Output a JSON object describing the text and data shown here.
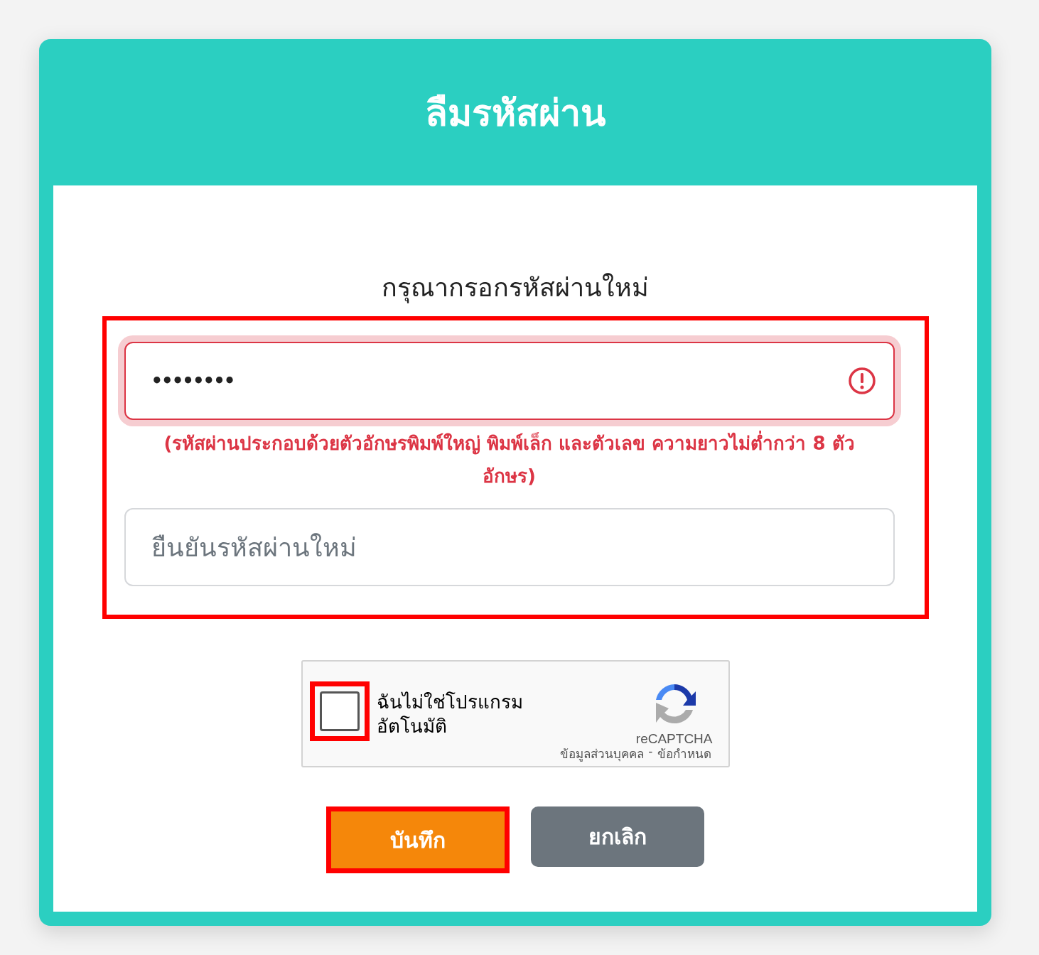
{
  "dialog": {
    "title": "ลืมรหัสผ่าน"
  },
  "prompt": "กรุณากรอกรหัสผ่านใหม่",
  "fields_highlighted": true,
  "fields": [
    {
      "kind": "password",
      "value": "••••••••",
      "invalid": true,
      "hint": "(รหัสผ่านประกอบด้วยตัวอักษรพิมพ์ใหญ่ พิมพ์เล็ก และตัวเลข ความยาวไม่ต่ำกว่า 8 ตัวอักษร)"
    },
    {
      "kind": "confirm",
      "placeholder": "ยืนยันรหัสผ่านใหม่",
      "invalid": false
    }
  ],
  "captcha": {
    "label_lines": [
      "ฉันไม่ใช่โปรแกรม",
      "อัตโนมัติ"
    ],
    "checked": false,
    "highlighted": true,
    "brand": "reCAPTCHA",
    "links": [
      "ข้อมูลส่วนบุคคล",
      "-",
      "ข้อกำหนด"
    ]
  },
  "buttons": [
    {
      "kind": "primary",
      "label": "บันทึก",
      "highlighted": true
    },
    {
      "kind": "secondary",
      "label": "ยกเลิก",
      "highlighted": false
    }
  ]
}
